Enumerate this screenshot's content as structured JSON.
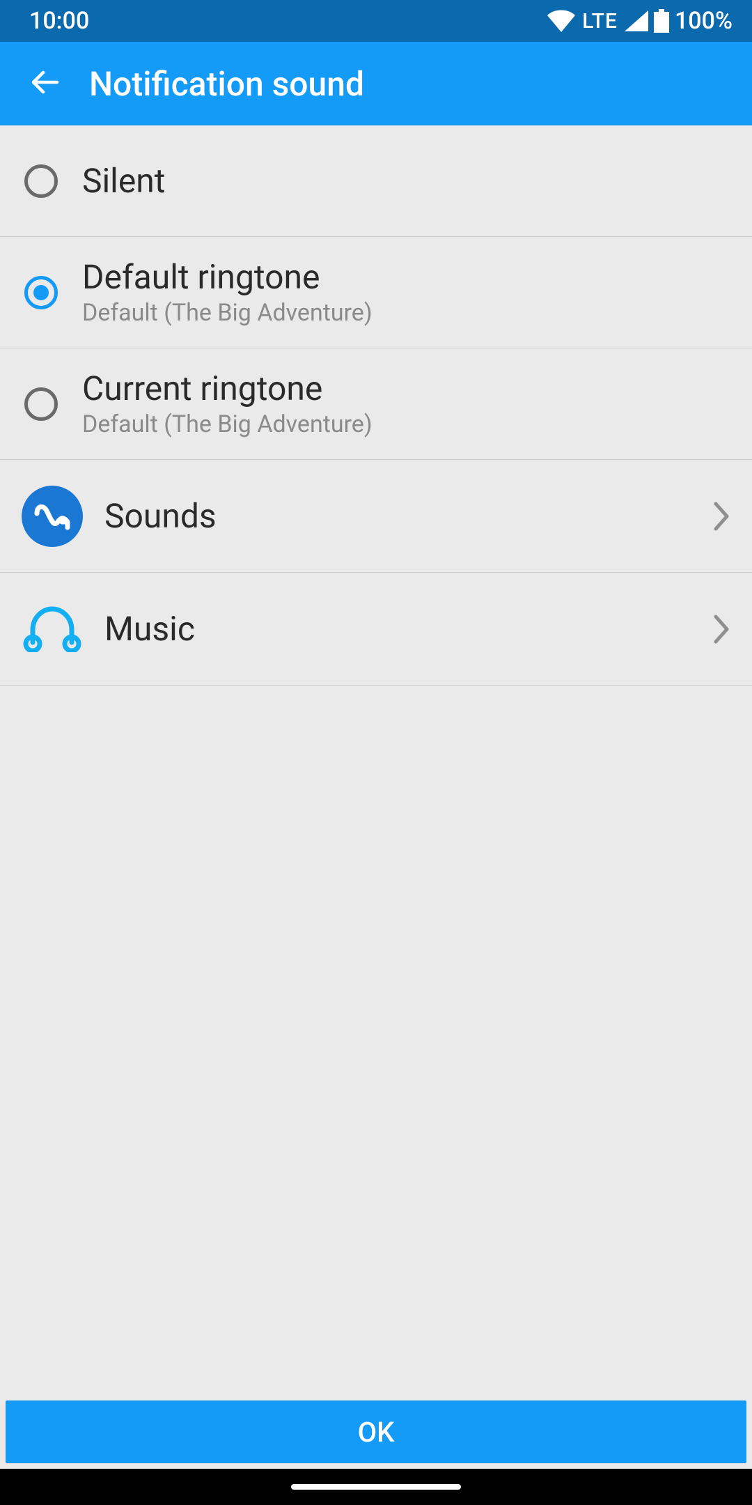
{
  "status": {
    "time": "10:00",
    "network": "LTE",
    "battery": "100%"
  },
  "appbar": {
    "title": "Notification sound"
  },
  "options": [
    {
      "label": "Silent",
      "subtitle": null,
      "selected": false
    },
    {
      "label": "Default ringtone",
      "subtitle": "Default (The Big Adventure)",
      "selected": true
    },
    {
      "label": "Current ringtone",
      "subtitle": "Default (The Big Adventure)",
      "selected": false
    }
  ],
  "nav": [
    {
      "label": "Sounds",
      "icon": "sounds-icon"
    },
    {
      "label": "Music",
      "icon": "headphones-icon"
    }
  ],
  "bottom": {
    "ok_label": "OK"
  }
}
